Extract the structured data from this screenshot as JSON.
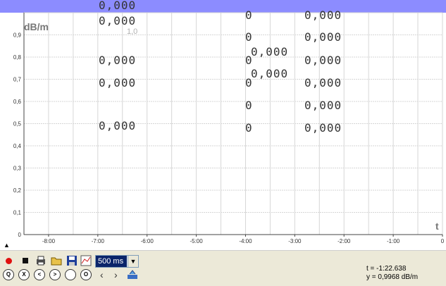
{
  "chart_data": {
    "type": "line",
    "ylabel": "dB/m",
    "xlabel": "t",
    "ylim": [
      0,
      1.0
    ],
    "y_ticks": [
      "0",
      "0,1",
      "0,2",
      "0,3",
      "0,4",
      "0,5",
      "0,6",
      "0,7",
      "0,8",
      "0,9"
    ],
    "y_top_label": "1,0",
    "x_ticks": [
      "-8:00",
      "-7:00",
      "-6:00",
      "-5:00",
      "-4:00",
      "-3:00",
      "-2:00",
      "-1:00",
      "0"
    ],
    "x_minutes": [
      -8,
      -7,
      -6,
      -5,
      -4,
      -3,
      -2,
      -1,
      0
    ],
    "grid": true
  },
  "stray_readings": [
    "0,000",
    "0,000",
    "0,000",
    "0,000",
    "0,000",
    "0",
    "0",
    "0",
    "0",
    "0",
    "0",
    "0,000",
    "0,000",
    "0,000",
    "0,000",
    "0,000",
    "0,000",
    "0,000",
    "0,000"
  ],
  "toolbar": {
    "time_interval": "500 ms",
    "icons": [
      "record-icon",
      "stop-icon",
      "print-icon",
      "open-folder-icon",
      "save-disk-icon",
      "settings-chart-icon"
    ],
    "zoom_icons": [
      "Q",
      "X",
      "<",
      ">",
      "",
      "O"
    ]
  },
  "readout": {
    "t": "t = -1:22.638",
    "y": "y = 0,9968 dB/m"
  }
}
